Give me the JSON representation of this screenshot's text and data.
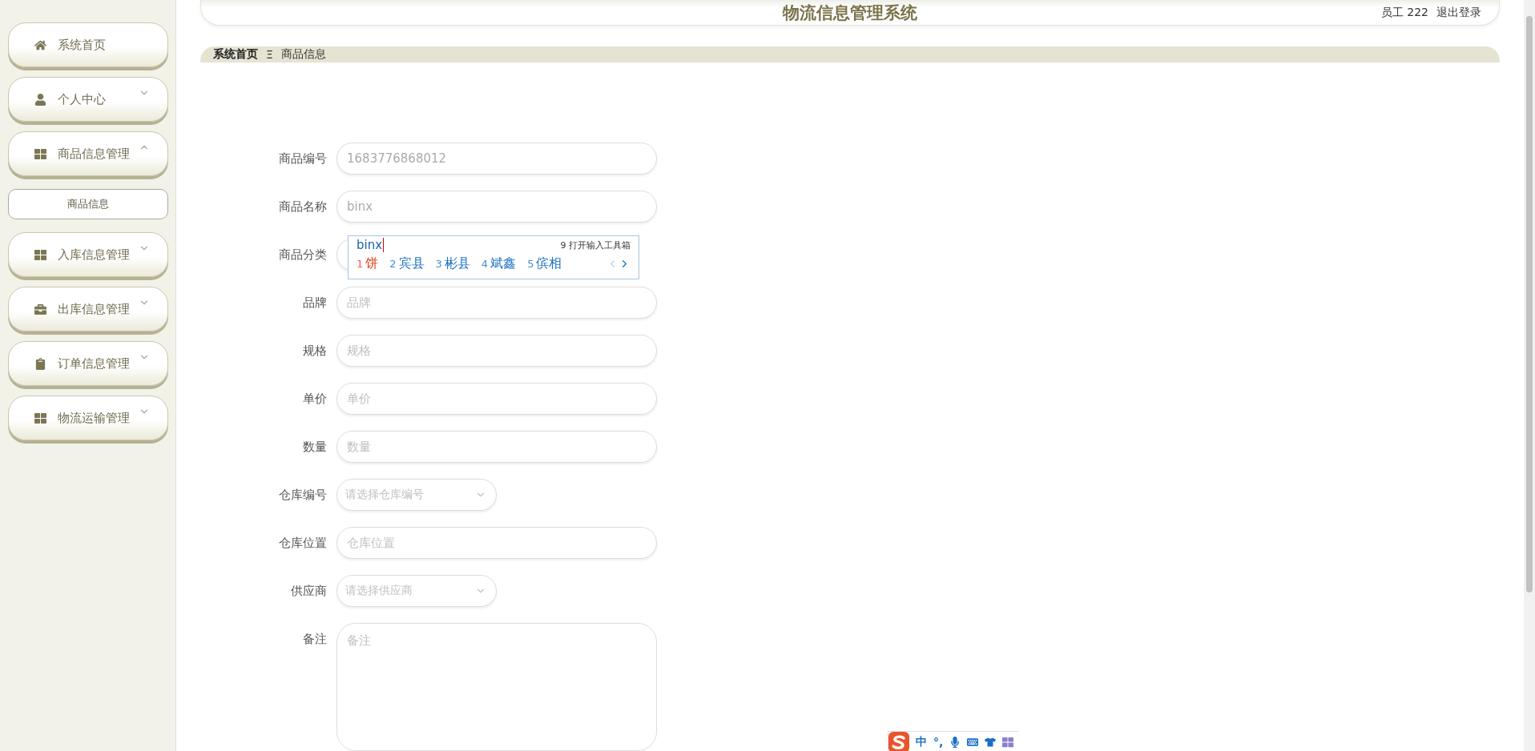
{
  "sidebar": {
    "items": [
      {
        "label": "系统首页"
      },
      {
        "label": "个人中心",
        "expanded": false
      },
      {
        "label": "商品信息管理",
        "expanded": true,
        "children": [
          {
            "label": "商品信息",
            "selected": true
          }
        ]
      },
      {
        "label": "入库信息管理",
        "expanded": false
      },
      {
        "label": "出库信息管理",
        "expanded": false
      },
      {
        "label": "订单信息管理",
        "expanded": false
      },
      {
        "label": "物流运输管理",
        "expanded": false
      }
    ]
  },
  "header": {
    "title": "物流信息管理系统",
    "user": "员工 222",
    "logout": "退出登录"
  },
  "breadcrumb": {
    "home": "系统首页",
    "separator": "Ξ",
    "current": "商品信息"
  },
  "form": {
    "fields": [
      {
        "kind": "input",
        "label": "商品编号",
        "value": "1683776868012"
      },
      {
        "kind": "input",
        "label": "商品名称",
        "value": "binx"
      },
      {
        "kind": "select",
        "label": "商品分类"
      },
      {
        "kind": "input",
        "label": "品牌",
        "placeholder": "品牌"
      },
      {
        "kind": "input",
        "label": "规格",
        "placeholder": "规格"
      },
      {
        "kind": "input",
        "label": "单价",
        "placeholder": "单价"
      },
      {
        "kind": "input",
        "label": "数量",
        "placeholder": "数量"
      },
      {
        "kind": "select",
        "label": "仓库编号",
        "placeholder": "请选择仓库编号"
      },
      {
        "kind": "input",
        "label": "仓库位置",
        "placeholder": "仓库位置"
      },
      {
        "kind": "select",
        "label": "供应商",
        "placeholder": "请选择供应商"
      },
      {
        "kind": "textarea",
        "label": "备注",
        "placeholder": "备注"
      }
    ]
  },
  "ime_popup": {
    "composition": "binx",
    "tool_hint": "9 打开输入工具箱",
    "candidates": [
      {
        "index": "1",
        "text": "饼",
        "selected": true
      },
      {
        "index": "2",
        "text": "宾县",
        "selected": false
      },
      {
        "index": "3",
        "text": "彬县",
        "selected": false
      },
      {
        "index": "4",
        "text": "斌鑫",
        "selected": false
      },
      {
        "index": "5",
        "text": "傧相",
        "selected": false
      }
    ]
  },
  "ime_toolbar": {
    "mode": "中",
    "punctuation": "°,"
  }
}
